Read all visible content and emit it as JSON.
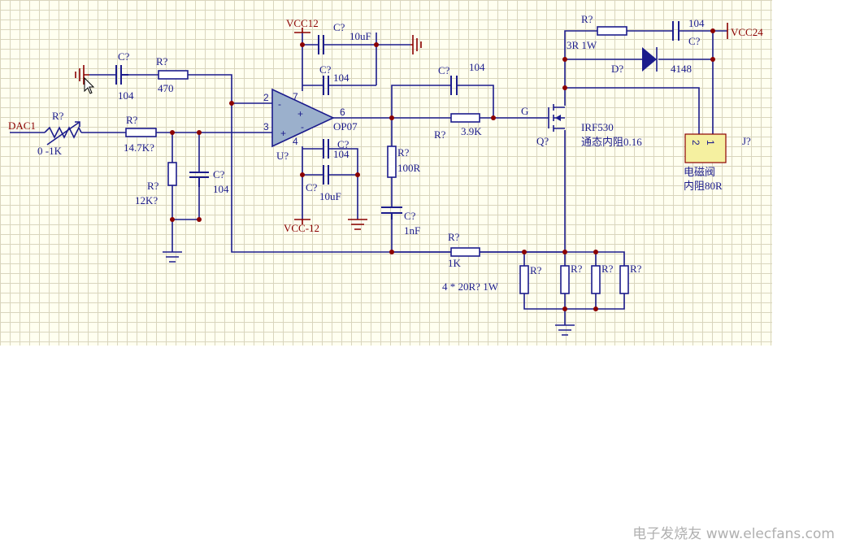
{
  "labels": {
    "vcc12": "VCC12",
    "vcc_12": "VCC-12",
    "vcc24": "VCC24",
    "dac1": "DAC1",
    "c_top_des": "C?",
    "c_top_val": "10uF",
    "c_fb_des": "C?",
    "c_fb_val": "104",
    "c_bot_des": "C?",
    "c_bot_val": "104",
    "c_bot2_des": "C?",
    "c_bot2_val": "10uF",
    "c_in_des": "C?",
    "c_in_val": "104",
    "r_in_des": "R?",
    "r_in_val": "470",
    "rv_des": "R?",
    "rv_val": "0 -1K",
    "r_147_des": "R?",
    "r_147_val": "14.7K?",
    "r_12_des": "R?",
    "r_12_val": "12K?",
    "c_104b_des": "C?",
    "c_104b_val": "104",
    "opamp_des": "U?",
    "opamp_part": "OP07",
    "pin2": "2",
    "pin3": "3",
    "pin6": "6",
    "pin7": "7",
    "pin4": "4",
    "minus": "-",
    "plus": "+",
    "c_out_des": "C?",
    "c_out_val": "104",
    "r_39_des": "R?",
    "r_39_val": "3.9K",
    "r_100_des": "R?",
    "r_100_val": "100R",
    "c_1n_des": "C?",
    "c_1n_val": "1nF",
    "r_1k_des": "R?",
    "r_1k_val": "1K",
    "r_sense_note": "4 * 20R? 1W",
    "rs1": "R?",
    "rs2": "R?",
    "rs3": "R?",
    "rs4": "R?",
    "gate": "G",
    "q_des": "Q?",
    "q_part": "IRF530",
    "q_note": "通态内阻0.16",
    "r_3r_des": "R?",
    "r_3r_val": "3R 1W",
    "c_24_val": "104",
    "c_24_des": "C?",
    "d_des": "D?",
    "d_val": "4148",
    "j_des": "J?",
    "j_pin2": "2",
    "j_pin1": "1",
    "coil_name": "电磁阀",
    "coil_note": "内阻80R"
  },
  "watermark": "电子发烧友 www.elecfans.com",
  "colors": {
    "wire": "#1c1c8c",
    "power": "#8b0000",
    "junction": "#8b0000",
    "sheet": "#fffff0"
  }
}
